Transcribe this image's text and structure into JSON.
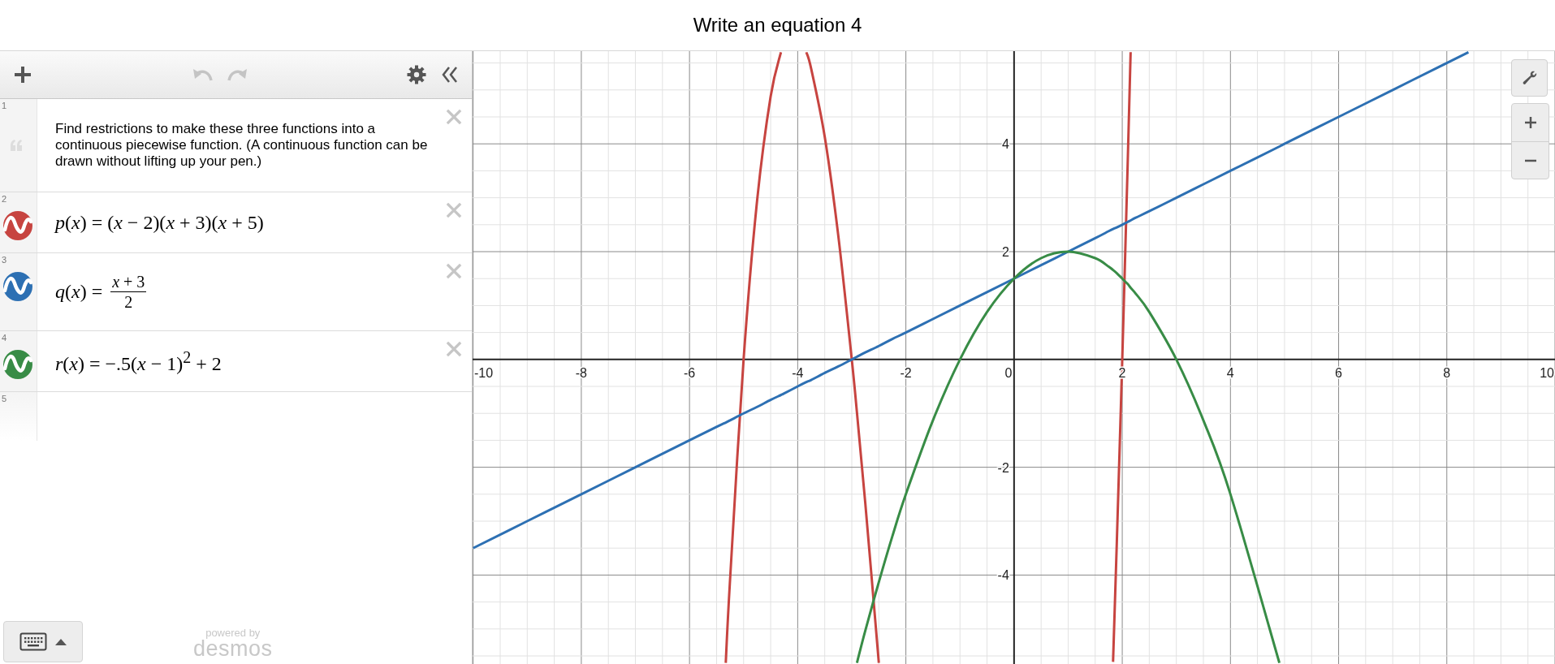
{
  "header": {
    "title": "Write an equation 4"
  },
  "toolbar": {
    "undo_disabled": true,
    "redo_disabled": true
  },
  "expressions": [
    {
      "number": "1",
      "kind": "note",
      "text": "Find restrictions to make these three functions into a continuous piecewise function. (A continuous function can be drawn without lifting up your pen.)"
    },
    {
      "number": "2",
      "kind": "function",
      "color": "#c74440",
      "formula": "*p*(*x*) = (*x* − 2)(*x* + 3)(*x* + 5)"
    },
    {
      "number": "3",
      "kind": "fraction",
      "color": "#2d70b3",
      "lhs": "*q*(*x*) =",
      "numerator": "*x* + 3",
      "denominator": "2"
    },
    {
      "number": "4",
      "kind": "function",
      "color": "#388c46",
      "formula": "*r*(*x*) = −.5(*x* − 1)$^{2}$ + 2"
    },
    {
      "number": "5",
      "kind": "empty"
    }
  ],
  "branding": {
    "line_1": "powered by",
    "line_2": "desmos"
  },
  "graph": {
    "chart_data": {
      "type": "line",
      "grid": true,
      "xlim": [
        -10.01,
        10
      ],
      "ylim": [
        -5.65,
        5.72
      ],
      "xticks": [
        -10,
        -8,
        -6,
        -4,
        -2,
        0,
        2,
        4,
        6,
        8,
        10
      ],
      "yticks": [
        -4,
        -2,
        2,
        4
      ],
      "x": [
        -10,
        -9,
        -8,
        -7,
        -6,
        -5.5,
        -5.33,
        -5.25,
        -5,
        -4.75,
        -4.5,
        -4.31,
        -4.25,
        -4,
        -3.84,
        -3.75,
        -3.5,
        -3.25,
        -3,
        -2.905,
        -2.75,
        -2.5,
        -2.25,
        -2,
        -1.5,
        -1,
        -0.5,
        0,
        0.5,
        1,
        1.5,
        1.75,
        1.83,
        1.9,
        2,
        2.1,
        2.155,
        2.25,
        2.5,
        3,
        3.5,
        4,
        4.905,
        5,
        6,
        7,
        8,
        8.4
      ],
      "series": [
        {
          "color": "#c74440",
          "values": [
            null,
            null,
            null,
            null,
            null,
            null,
            -5.63,
            -4.08,
            0,
            2.95,
            4.88,
            5.7,
            null,
            null,
            5.7,
            5.39,
            4.13,
            2.3,
            0,
            -0.98,
            -2.67,
            -5.63,
            null,
            null,
            null,
            null,
            null,
            null,
            null,
            null,
            null,
            null,
            -5.61,
            -3.38,
            0,
            3.62,
            5.7,
            null,
            null,
            null,
            null,
            null,
            null,
            null,
            null,
            null,
            null,
            null
          ]
        },
        {
          "color": "#2d70b3",
          "values": [
            -3.5,
            -3,
            -2.5,
            -2,
            -1.5,
            -1.25,
            -1.17,
            -1.13,
            -1,
            -0.88,
            -0.75,
            -0.66,
            -0.63,
            -0.5,
            -0.42,
            -0.38,
            -0.25,
            -0.13,
            0,
            0.05,
            0.13,
            0.25,
            0.38,
            0.5,
            0.75,
            1,
            1.25,
            1.5,
            1.75,
            2,
            2.25,
            2.38,
            2.42,
            2.45,
            2.5,
            2.55,
            2.58,
            2.63,
            2.75,
            3,
            3.25,
            3.5,
            3.95,
            4,
            4.5,
            5,
            5.5,
            5.7
          ]
        },
        {
          "color": "#388c46",
          "values": [
            null,
            null,
            null,
            null,
            null,
            null,
            null,
            null,
            null,
            null,
            null,
            null,
            null,
            null,
            null,
            null,
            null,
            null,
            null,
            -5.63,
            -5.03,
            -4.13,
            -3.28,
            -2.5,
            -1.13,
            0,
            0.88,
            1.5,
            1.88,
            2,
            1.88,
            1.72,
            1.66,
            1.6,
            1.5,
            1.4,
            1.33,
            1.22,
            0.88,
            0,
            -1.13,
            -2.5,
            -5.63,
            null,
            null,
            null,
            null,
            null
          ]
        }
      ]
    }
  }
}
